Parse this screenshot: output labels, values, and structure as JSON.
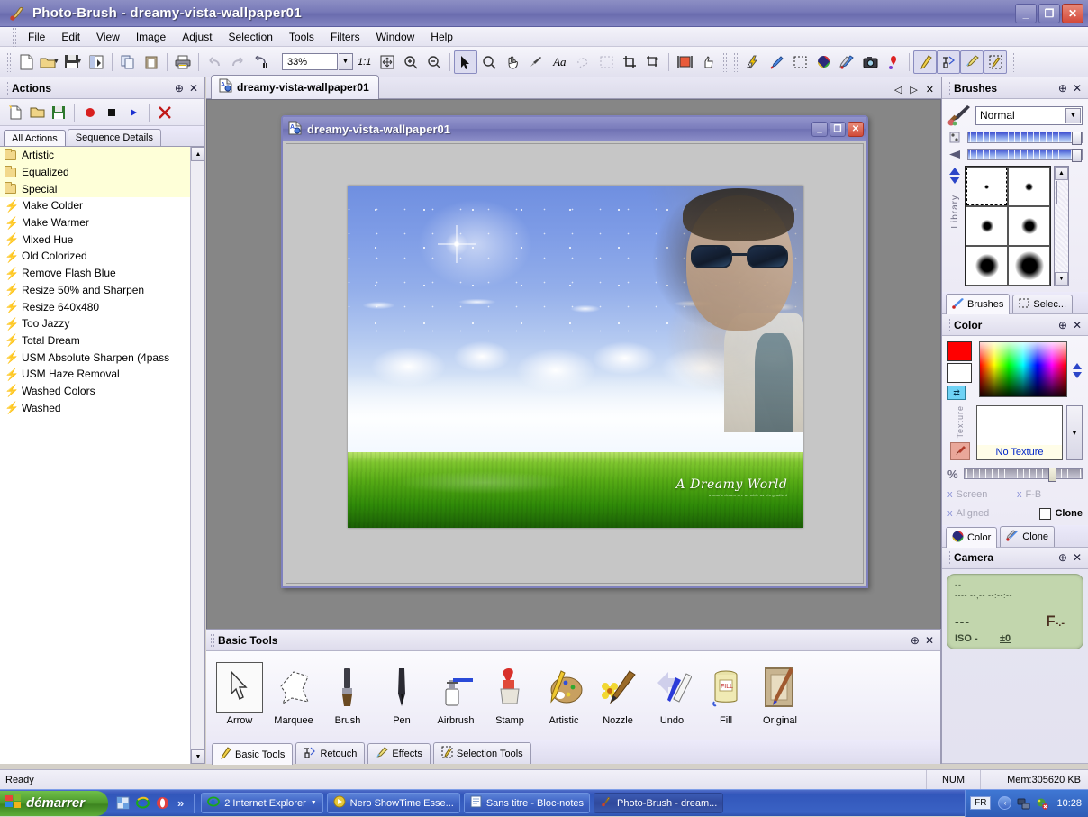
{
  "app": {
    "title": "Photo-Brush - dreamy-vista-wallpaper01",
    "icon": "photo-brush-icon",
    "window_buttons": {
      "minimize": "_",
      "maximize": "❐",
      "close": "✕"
    }
  },
  "menu": {
    "items": [
      {
        "label": "File",
        "accel": "F"
      },
      {
        "label": "Edit",
        "accel": "E"
      },
      {
        "label": "View",
        "accel": "V"
      },
      {
        "label": "Image",
        "accel": "I"
      },
      {
        "label": "Adjust",
        "accel": "A"
      },
      {
        "label": "Selection",
        "accel": "S"
      },
      {
        "label": "Tools",
        "accel": "T"
      },
      {
        "label": "Filters",
        "accel": "l"
      },
      {
        "label": "Window",
        "accel": "W"
      },
      {
        "label": "Help",
        "accel": "H"
      }
    ]
  },
  "toolbar": {
    "zoom_value": "33%",
    "one_to_one_label": "1:1",
    "buttons": [
      "new-document-icon",
      "open-file-icon",
      "save-file-icon",
      "batch-icon",
      "copy-icon",
      "paste-icon",
      "print-icon",
      "undo-icon",
      "redo-icon",
      "undo-history-icon",
      "fit-to-window-icon",
      "zoom-in-icon",
      "zoom-out-icon",
      "arrow-tool-icon",
      "magnifier-tool-icon",
      "hand-tool-icon",
      "eyedropper-tool-icon",
      "text-tool-icon",
      "lasso-tool-icon",
      "marquee-tool-icon",
      "crop-tool-icon",
      "perspective-tool-icon",
      "resize-canvas-icon",
      "thumb-icon",
      "auto-levels-icon",
      "paint-brush-icon",
      "selection-rect-icon",
      "color-wheel-icon",
      "clone-brushes-icon",
      "camera-icon",
      "red-pin-icon",
      "pencil-icon",
      "retouch-icon",
      "effects-icon",
      "selection-tools-icon"
    ]
  },
  "actions_panel": {
    "title": "Actions",
    "pin": "pin-icon",
    "close": "close-icon",
    "toolbar_buttons": [
      "new-action-icon",
      "open-action-icon",
      "save-action-icon",
      "record-icon",
      "stop-icon",
      "play-icon",
      "delete-icon"
    ],
    "tabs": [
      {
        "label": "All Actions",
        "selected": true
      },
      {
        "label": "Sequence Details",
        "selected": false
      }
    ],
    "items": [
      {
        "label": "Artistic",
        "type": "folder"
      },
      {
        "label": "Equalized",
        "type": "folder"
      },
      {
        "label": "Special",
        "type": "folder"
      },
      {
        "label": "Make Colder",
        "type": "action"
      },
      {
        "label": "Make Warmer",
        "type": "action"
      },
      {
        "label": "Mixed Hue",
        "type": "action"
      },
      {
        "label": "Old Colorized",
        "type": "action"
      },
      {
        "label": "Remove Flash Blue",
        "type": "action"
      },
      {
        "label": "Resize 50% and Sharpen",
        "type": "action"
      },
      {
        "label": "Resize 640x480",
        "type": "action"
      },
      {
        "label": "Too Jazzy",
        "type": "action"
      },
      {
        "label": "Total Dream",
        "type": "action"
      },
      {
        "label": "USM Absolute Sharpen (4pass",
        "type": "action"
      },
      {
        "label": "USM Haze Removal",
        "type": "action"
      },
      {
        "label": "Washed Colors",
        "type": "action"
      },
      {
        "label": "Washed",
        "type": "action"
      }
    ]
  },
  "document": {
    "tab_label": "dreamy-vista-wallpaper01",
    "tab_icon": "image-document-icon",
    "nav": {
      "prev": "◁",
      "next": "▷",
      "close": "✕"
    },
    "window_title": "dreamy-vista-wallpaper01",
    "window_buttons": {
      "minimize": "_",
      "maximize": "❐",
      "close": "✕"
    },
    "image": {
      "signature": "A Dreamy World",
      "signature_sub": "a man's dream are as wide as his gradient"
    }
  },
  "basic_tools": {
    "title": "Basic Tools",
    "pin": "pin-icon",
    "close": "close-icon",
    "tools": [
      {
        "label": "Arrow",
        "icon": "arrow-tool-icon",
        "selected": true
      },
      {
        "label": "Marquee",
        "icon": "marquee-tool-icon",
        "selected": false
      },
      {
        "label": "Brush",
        "icon": "brush-tool-icon",
        "selected": false
      },
      {
        "label": "Pen",
        "icon": "pen-tool-icon",
        "selected": false
      },
      {
        "label": "Airbrush",
        "icon": "airbrush-tool-icon",
        "selected": false
      },
      {
        "label": "Stamp",
        "icon": "stamp-tool-icon",
        "selected": false
      },
      {
        "label": "Artistic",
        "icon": "artistic-tool-icon",
        "selected": false
      },
      {
        "label": "Nozzle",
        "icon": "nozzle-tool-icon",
        "selected": false
      },
      {
        "label": "Undo",
        "icon": "undo-tool-icon",
        "selected": false
      },
      {
        "label": "Fill",
        "icon": "fill-tool-icon",
        "selected": false
      },
      {
        "label": "Original",
        "icon": "original-tool-icon",
        "selected": false
      }
    ],
    "tabs": [
      {
        "label": "Basic Tools",
        "icon": "pencil-icon",
        "selected": true
      },
      {
        "label": "Retouch",
        "icon": "retouch-icon",
        "selected": false
      },
      {
        "label": "Effects",
        "icon": "effects-icon",
        "selected": false
      },
      {
        "label": "Selection Tools",
        "icon": "selection-tools-icon",
        "selected": false
      }
    ]
  },
  "brushes_panel": {
    "title": "Brushes",
    "pin": "pin-icon",
    "close": "close-icon",
    "mode": "Normal",
    "library_label": "Library",
    "tabs": [
      {
        "label": "Brushes",
        "icon": "brush-icon",
        "selected": true
      },
      {
        "label": "Selec...",
        "icon": "selection-icon",
        "selected": false
      }
    ]
  },
  "color_panel": {
    "title": "Color",
    "pin": "pin-icon",
    "close": "close-icon",
    "foreground": "#ff0000",
    "background": "#ffffff",
    "texture_caption": "No Texture",
    "texture_label": "Texture",
    "percent_symbol": "%",
    "options": [
      {
        "label": "Screen",
        "mark": "x",
        "enabled": false
      },
      {
        "label": "F-B",
        "mark": "x",
        "enabled": false
      },
      {
        "label": "Aligned",
        "mark": "x",
        "enabled": false
      },
      {
        "label": "Clone",
        "mark": "checkbox",
        "enabled": true
      }
    ],
    "tabs": [
      {
        "label": "Color",
        "icon": "color-wheel-icon",
        "selected": true
      },
      {
        "label": "Clone",
        "icon": "clone-brush-icon",
        "selected": false
      }
    ]
  },
  "camera_panel": {
    "title": "Camera",
    "pin": "pin-icon",
    "close": "close-icon",
    "line1": "--",
    "line2": "---- --,-- --:--:--",
    "shutter": "---",
    "aperture": "F",
    "aperture_sub": "-.-",
    "iso": "ISO -",
    "ev": "±0"
  },
  "statusbar": {
    "message": "Ready",
    "num_lock": "NUM",
    "memory": "Mem:305620 KB"
  },
  "taskbar": {
    "start_label": "démarrer",
    "quick_launch": [
      "show-desktop-icon",
      "internet-explorer-icon",
      "opera-icon"
    ],
    "more_chevron": "»",
    "tasks": [
      {
        "label": "2 Internet Explorer",
        "icon": "internet-explorer-icon",
        "active": false,
        "has_dropdown": true
      },
      {
        "label": "Nero ShowTime Esse...",
        "icon": "nero-showtime-icon",
        "active": false,
        "has_dropdown": false
      },
      {
        "label": "Sans titre - Bloc-notes",
        "icon": "notepad-icon",
        "active": false,
        "has_dropdown": false
      },
      {
        "label": "Photo-Brush - dream...",
        "icon": "photo-brush-icon",
        "active": true,
        "has_dropdown": false
      }
    ],
    "tray": {
      "language": "FR",
      "expand": "‹",
      "icons": [
        "network-icon",
        "antivirus-icon"
      ],
      "clock": "10:28"
    }
  }
}
